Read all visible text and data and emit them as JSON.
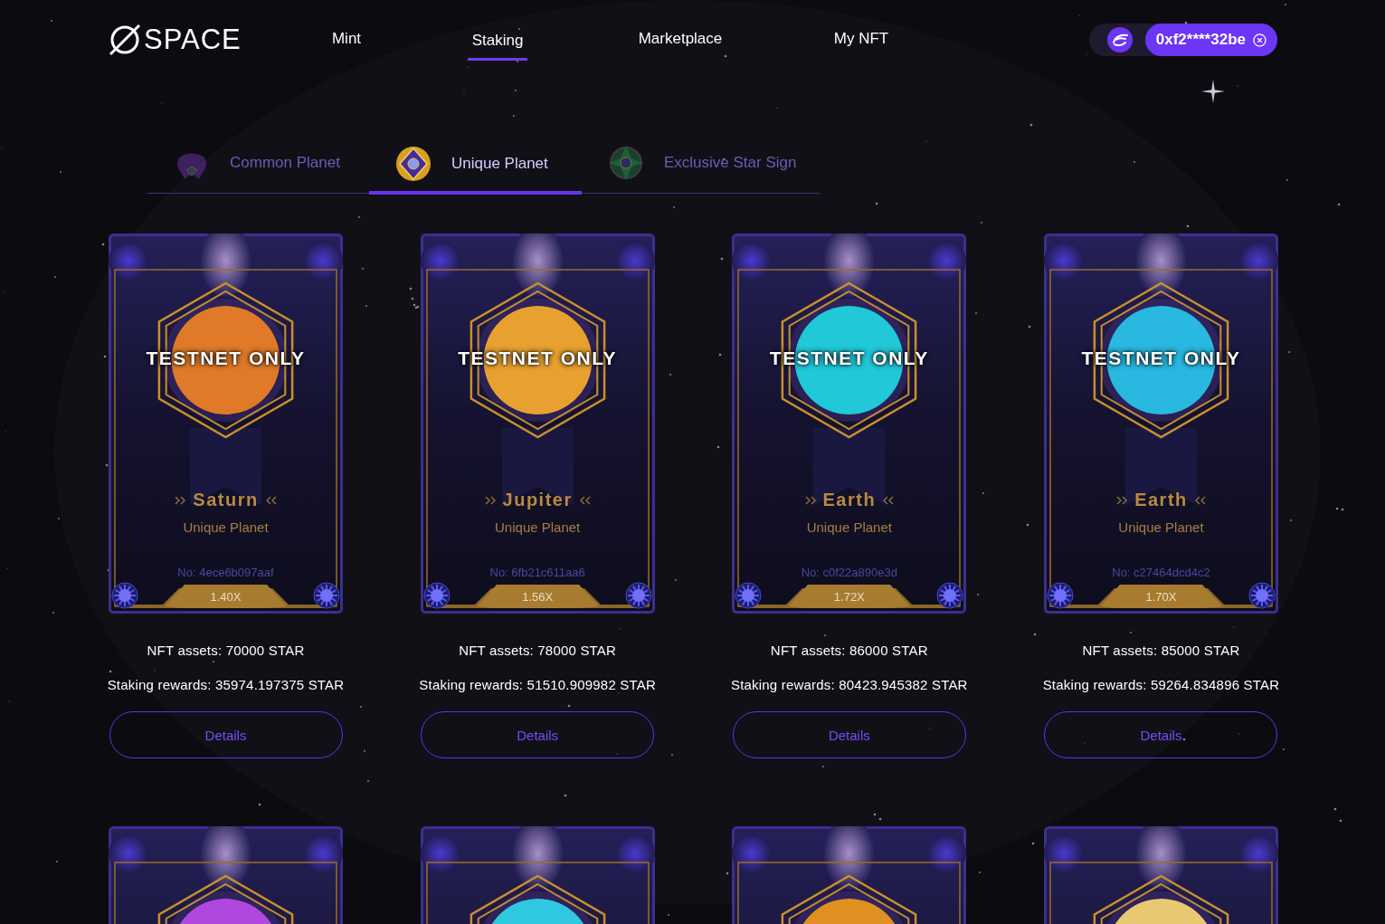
{
  "logo": {
    "text": "SPACE"
  },
  "nav": [
    {
      "label": "Mint",
      "selected": false
    },
    {
      "label": "Staking",
      "selected": true
    },
    {
      "label": "Marketplace",
      "selected": false
    },
    {
      "label": "My NFT",
      "selected": false
    }
  ],
  "wallet": {
    "address": "0xf2****32be"
  },
  "tabs": [
    {
      "label": "Common Planet",
      "selected": false
    },
    {
      "label": "Unique Planet",
      "selected": true
    },
    {
      "label": "Exclusive Star Sign",
      "selected": false
    }
  ],
  "nfts": [
    {
      "banner": "TESTNET ONLY",
      "name": "Saturn",
      "type": "Unique Planet",
      "number": "No: 4ece6b097aaf",
      "multiplier": "1.40X",
      "color": "#e07a28",
      "assets": "NFT assets: 70000 STAR",
      "rewards": "Staking rewards: 35974.197375 STAR",
      "button": "Details"
    },
    {
      "banner": "TESTNET ONLY",
      "name": "Jupiter",
      "type": "Unique Planet",
      "number": "No: 6fb21c611aa6",
      "multiplier": "1.56X",
      "color": "#e8a030",
      "assets": "NFT assets: 78000 STAR",
      "rewards": "Staking rewards: 51510.909982 STAR",
      "button": "Details"
    },
    {
      "banner": "TESTNET ONLY",
      "name": "Earth",
      "type": "Unique Planet",
      "number": "No: c0f22a890e3d",
      "multiplier": "1.72X",
      "color": "#20c8d8",
      "assets": "NFT assets: 86000 STAR",
      "rewards": "Staking rewards: 80423.945382 STAR",
      "button": "Details"
    },
    {
      "banner": "TESTNET ONLY",
      "name": "Earth",
      "type": "Unique Planet",
      "number": "No: c27464dcd4c2",
      "multiplier": "1.70X",
      "color": "#28b8e0",
      "assets": "NFT assets: 85000 STAR",
      "rewards": "Staking rewards: 59264.834896 STAR",
      "button": "Details"
    },
    {
      "color": "#b048e0"
    },
    {
      "color": "#30c8e0"
    },
    {
      "color": "#e09020"
    },
    {
      "color": "#e8c870"
    }
  ]
}
